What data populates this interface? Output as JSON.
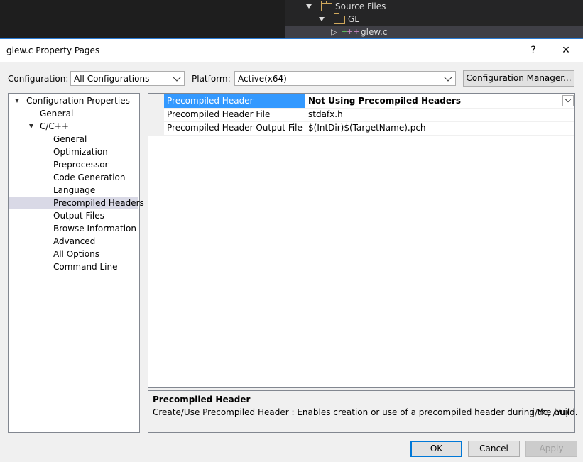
{
  "solution_tree": {
    "items": [
      {
        "label": "Source Files"
      },
      {
        "label": "GL"
      },
      {
        "label": "glew.c"
      }
    ]
  },
  "dialog": {
    "title": "glew.c Property Pages",
    "help_label": "?",
    "close_label": "✕",
    "configuration_label": "Configuration:",
    "configuration_value": "All Configurations",
    "platform_label": "Platform:",
    "platform_value": "Active(x64)",
    "config_manager_label": "Configuration Manager..."
  },
  "nav": {
    "items": [
      {
        "label": "Configuration Properties"
      },
      {
        "label": "General"
      },
      {
        "label": "C/C++"
      },
      {
        "label": "General"
      },
      {
        "label": "Optimization"
      },
      {
        "label": "Preprocessor"
      },
      {
        "label": "Code Generation"
      },
      {
        "label": "Language"
      },
      {
        "label": "Precompiled Headers"
      },
      {
        "label": "Output Files"
      },
      {
        "label": "Browse Information"
      },
      {
        "label": "Advanced"
      },
      {
        "label": "All Options"
      },
      {
        "label": "Command Line"
      }
    ]
  },
  "properties": {
    "rows": [
      {
        "name": "Precompiled Header",
        "value": "Not Using Precompiled Headers"
      },
      {
        "name": "Precompiled Header File",
        "value": "stdafx.h"
      },
      {
        "name": "Precompiled Header Output File",
        "value": "$(IntDir)$(TargetName).pch"
      }
    ]
  },
  "description": {
    "title": "Precompiled Header",
    "text": "Create/Use Precompiled Header : Enables creation or use of a precompiled header during the build.",
    "switches": "(/Yc, /Yu)"
  },
  "buttons": {
    "ok": "OK",
    "cancel": "Cancel",
    "apply": "Apply"
  }
}
